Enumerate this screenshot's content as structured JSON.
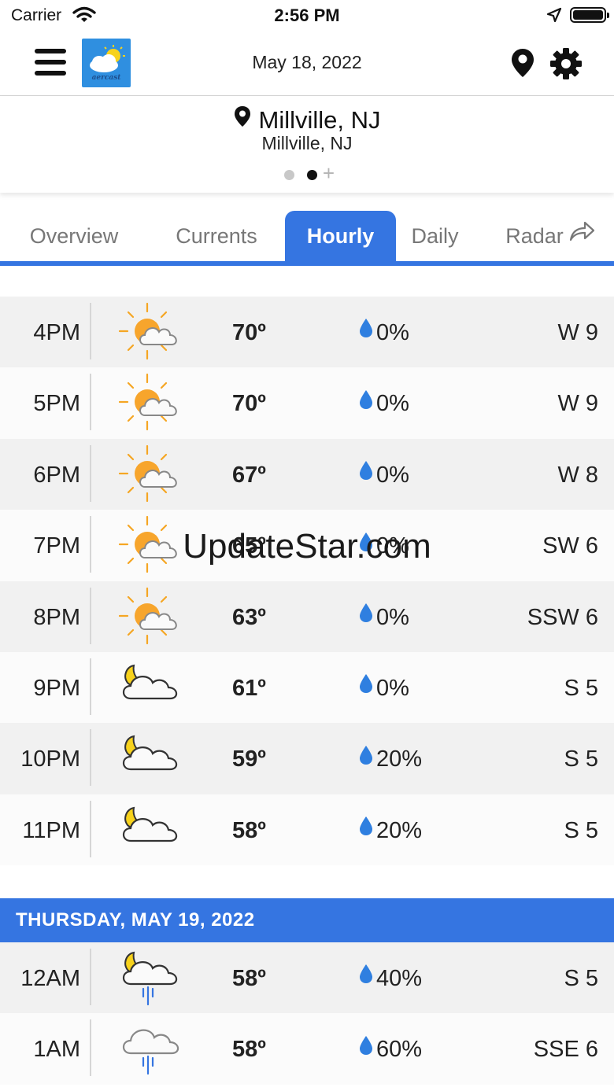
{
  "status_bar": {
    "carrier": "Carrier",
    "time": "2:56 PM"
  },
  "header": {
    "date": "May 18, 2022",
    "logo_text": "aercast"
  },
  "location": {
    "title": "Millville, NJ",
    "subtitle": "Millville, NJ",
    "page_plus": "+"
  },
  "tabs": [
    {
      "label": "Overview"
    },
    {
      "label": "Currents"
    },
    {
      "label": "Hourly"
    },
    {
      "label": "Daily"
    },
    {
      "label": "Radar"
    }
  ],
  "today_rows": [
    {
      "time": "4PM",
      "icon": "partly-sunny-icon",
      "temp": "70º",
      "precip": "0%",
      "wind": "W 9"
    },
    {
      "time": "5PM",
      "icon": "partly-sunny-icon",
      "temp": "70º",
      "precip": "0%",
      "wind": "W 9"
    },
    {
      "time": "6PM",
      "icon": "partly-sunny-icon",
      "temp": "67º",
      "precip": "0%",
      "wind": "W 8"
    },
    {
      "time": "7PM",
      "icon": "partly-sunny-icon",
      "temp": "65º",
      "precip": "0%",
      "wind": "SW 6"
    },
    {
      "time": "8PM",
      "icon": "partly-sunny-icon",
      "temp": "63º",
      "precip": "0%",
      "wind": "SSW 6"
    },
    {
      "time": "9PM",
      "icon": "partly-cloudy-night-icon",
      "temp": "61º",
      "precip": "0%",
      "wind": "S 5"
    },
    {
      "time": "10PM",
      "icon": "partly-cloudy-night-icon",
      "temp": "59º",
      "precip": "20%",
      "wind": "S 5"
    },
    {
      "time": "11PM",
      "icon": "partly-cloudy-night-icon",
      "temp": "58º",
      "precip": "20%",
      "wind": "S 5"
    }
  ],
  "next_day": {
    "header": "THURSDAY, MAY 19, 2022"
  },
  "next_rows": [
    {
      "time": "12AM",
      "icon": "night-rain-icon",
      "temp": "58º",
      "precip": "40%",
      "wind": "S 5"
    },
    {
      "time": "1AM",
      "icon": "rain-cloud-icon",
      "temp": "58º",
      "precip": "60%",
      "wind": "SSE 6"
    }
  ],
  "watermark": "UpdateStar.com",
  "colors": {
    "accent": "#3575e1",
    "drop": "#2f7fe0",
    "sun": "#f5a623"
  }
}
